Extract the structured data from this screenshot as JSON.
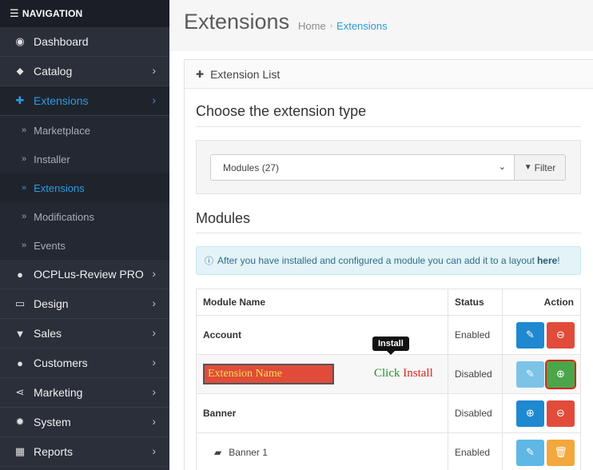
{
  "sidebar": {
    "header": "NAVIGATION",
    "items": [
      {
        "label": "Dashboard",
        "icon": "dashboard-icon",
        "glyph": "◉"
      },
      {
        "label": "Catalog",
        "icon": "tag-icon",
        "glyph": "⬥"
      },
      {
        "label": "Extensions",
        "icon": "puzzle-icon",
        "glyph": "✚"
      },
      {
        "label": "OCPLus-Review PRO",
        "icon": "chat-bubbles-icon",
        "glyph": "●"
      },
      {
        "label": "Design",
        "icon": "monitor-icon",
        "glyph": "▭"
      },
      {
        "label": "Sales",
        "icon": "shopping-cart-icon",
        "glyph": "▼"
      },
      {
        "label": "Customers",
        "icon": "user-icon",
        "glyph": "●"
      },
      {
        "label": "Marketing",
        "icon": "share-icon",
        "glyph": "⋖"
      },
      {
        "label": "System",
        "icon": "cog-icon",
        "glyph": "✹"
      },
      {
        "label": "Reports",
        "icon": "bar-chart-icon",
        "glyph": "▦"
      }
    ],
    "sub_items": [
      {
        "label": "Marketplace"
      },
      {
        "label": "Installer"
      },
      {
        "label": "Extensions"
      },
      {
        "label": "Modifications"
      },
      {
        "label": "Events"
      }
    ]
  },
  "header": {
    "title": "Extensions",
    "breadcrumb": {
      "home": "Home",
      "current": "Extensions"
    }
  },
  "panel": {
    "heading": "Extension List",
    "choose_title": "Choose the extension type",
    "select_value": "Modules (27)",
    "filter_label": "Filter",
    "modules_title": "Modules",
    "alert_text": "After you have installed and configured a module you can add it to a layout",
    "alert_link": "here",
    "alert_suffix": "!"
  },
  "table": {
    "headers": {
      "name": "Module Name",
      "status": "Status",
      "action": "Action"
    },
    "rows": [
      {
        "name": "Account",
        "status": "Enabled"
      },
      {
        "name": "Extension Name",
        "status": "Disabled",
        "annotation": "Click",
        "annotation_emph": "Install"
      },
      {
        "name": "Banner",
        "status": "Disabled"
      },
      {
        "name": "Banner 1",
        "status": "Enabled"
      }
    ]
  },
  "tooltip": "Install",
  "colors": {
    "sidebar_bg": "#2b2f3a",
    "accent_blue": "#2d9be0",
    "danger": "#e14b3a",
    "success": "#4aa64a",
    "warning": "#f2a83b"
  }
}
